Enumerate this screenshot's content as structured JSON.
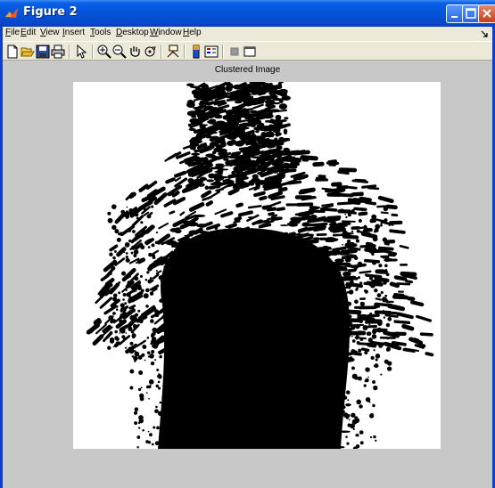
{
  "window": {
    "title": "Figure 2"
  },
  "menu": [
    {
      "underline": "F",
      "rest": "ile"
    },
    {
      "underline": "E",
      "rest": "dit"
    },
    {
      "underline": "V",
      "rest": "iew"
    },
    {
      "underline": "I",
      "rest": "nsert"
    },
    {
      "underline": "T",
      "rest": "ools"
    },
    {
      "underline": "D",
      "rest": "esktop"
    },
    {
      "underline": "W",
      "rest": "indow"
    },
    {
      "underline": "H",
      "rest": "elp"
    }
  ],
  "toolbar": {
    "icons": [
      "new-file-icon",
      "open-file-icon",
      "save-icon",
      "print-icon",
      "pointer-icon",
      "zoom-in-icon",
      "zoom-out-icon",
      "pan-icon",
      "rotate-icon",
      "data-cursor-icon",
      "colorbar-icon",
      "legend-icon",
      "hide-plot-tools-icon",
      "show-plot-tools-icon"
    ]
  },
  "figure": {
    "axes_title": "Clustered Image"
  },
  "colors": {
    "titlebar": "#0553d8",
    "chrome": "#ece9d8",
    "figure_background": "#c8c8c8",
    "image_foreground": "#000000",
    "image_background": "#ffffff"
  }
}
